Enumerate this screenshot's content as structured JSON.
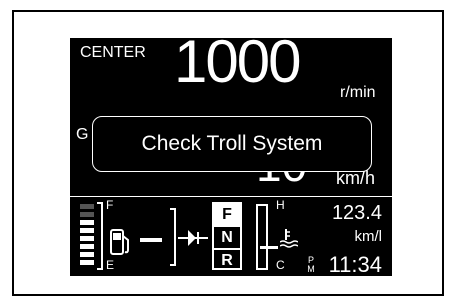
{
  "display": {
    "mode_label": "CENTER",
    "rpm_value": "1000",
    "rpm_unit": "r/min",
    "second_label_partial": "G",
    "speed_value": "10",
    "speed_unit": "km/h",
    "popup_message": "Check Troll System",
    "fuel": {
      "full_label": "F",
      "empty_label": "E",
      "level_fraction": 0.75,
      "bars_total": 8
    },
    "gears": [
      "F",
      "N",
      "R"
    ],
    "active_gear": "F",
    "temperature": {
      "hot_label": "H",
      "cold_label": "C",
      "level_fraction": 0.4
    },
    "fuel_economy_value": "123.4",
    "fuel_economy_unit": "km/l",
    "clock": {
      "period_top": "P",
      "period_bottom": "M",
      "time": "11:34"
    }
  },
  "colors": {
    "screen_bg": "#000000",
    "text": "#ffffff",
    "frame_border": "#000000",
    "page_bg": "#ffffff"
  },
  "icons": [
    "fuel-pump-icon",
    "trolling-motor-icon",
    "coolant-temperature-icon"
  ]
}
